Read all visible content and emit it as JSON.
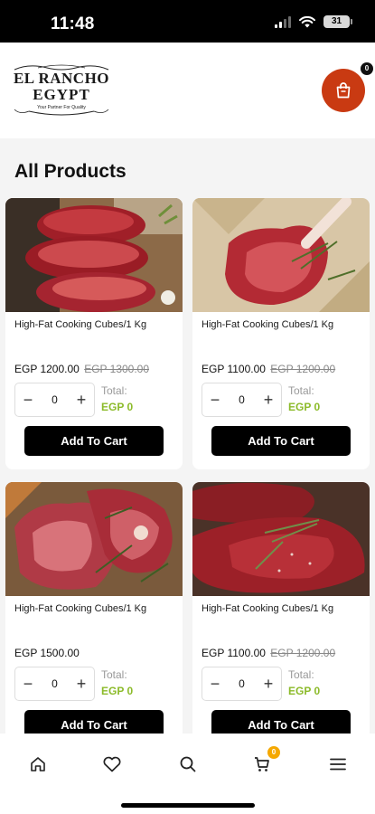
{
  "status_bar": {
    "time": "11:48",
    "battery": "31"
  },
  "header": {
    "logo_line1": "EL RANCHO",
    "logo_line2": "EGYPT",
    "logo_tagline": "Your Partner For Quality",
    "cart_icon": "shopping-bag-icon",
    "cart_count": "0",
    "accent_color": "#c93a12"
  },
  "page_title": "All Products",
  "products": [
    {
      "name": "High-Fat Cooking Cubes/1 Kg",
      "price": "EGP 1200.00",
      "old_price": "EGP 1300.00",
      "quantity": "0",
      "total_label": "Total:",
      "total_value": "EGP 0",
      "button": "Add To Cart"
    },
    {
      "name": "High-Fat Cooking Cubes/1 Kg",
      "price": "EGP 1100.00",
      "old_price": "EGP 1200.00",
      "quantity": "0",
      "total_label": "Total:",
      "total_value": "EGP 0",
      "button": "Add To Cart"
    },
    {
      "name": "High-Fat Cooking Cubes/1 Kg",
      "price": "EGP 1500.00",
      "old_price": "",
      "quantity": "0",
      "total_label": "Total:",
      "total_value": "EGP 0",
      "button": "Add To Cart"
    },
    {
      "name": "High-Fat Cooking Cubes/1 Kg",
      "price": "EGP 1100.00",
      "old_price": "EGP 1200.00",
      "quantity": "0",
      "total_label": "Total:",
      "total_value": "EGP 0",
      "button": "Add To Cart"
    }
  ],
  "stepper": {
    "minus": "−",
    "plus": "+"
  },
  "bottom_nav": {
    "items": [
      "home-icon",
      "heart-icon",
      "search-icon",
      "cart-icon",
      "menu-icon"
    ],
    "cart_badge": "0",
    "badge_color": "#f5a800"
  }
}
